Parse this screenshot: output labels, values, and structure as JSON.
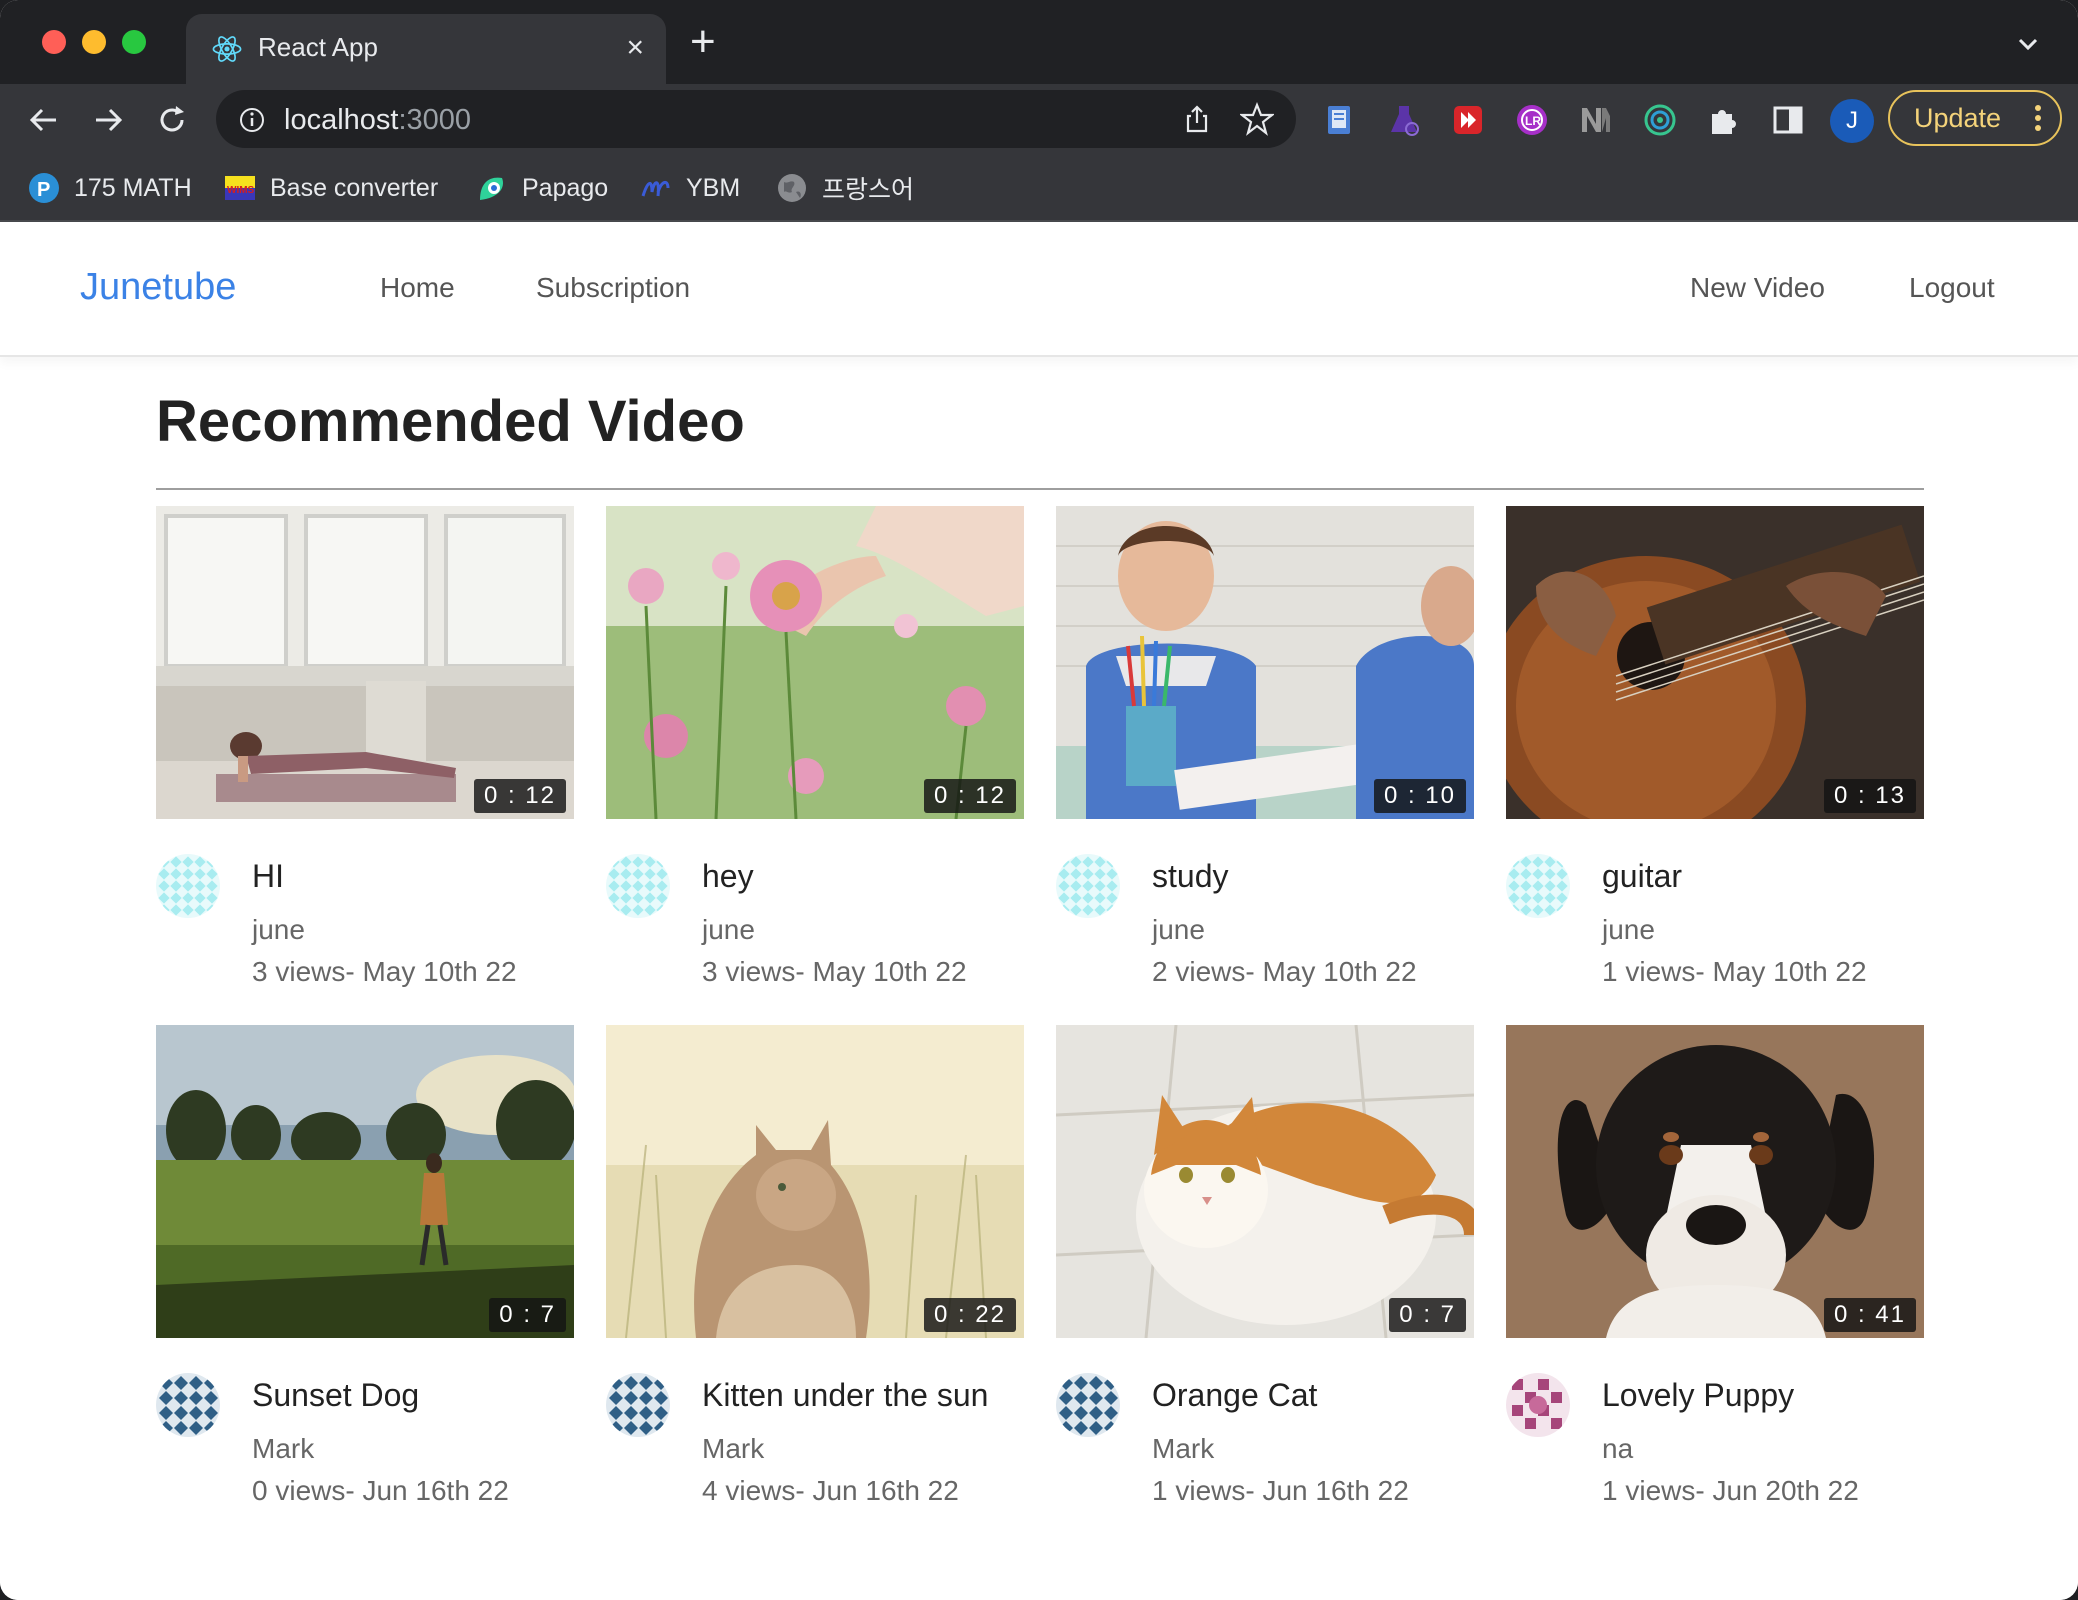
{
  "browser": {
    "tab_title": "React App",
    "tab_close": "×",
    "new_tab": "+",
    "url_host": "localhost",
    "url_port": ":3000",
    "profile_initial": "J",
    "update_label": "Update",
    "bookmarks": [
      {
        "label": "175 MATH",
        "icon": "pearson-icon"
      },
      {
        "label": "Base converter",
        "icon": "wims-icon"
      },
      {
        "label": "Papago",
        "icon": "papago-icon"
      },
      {
        "label": "YBM",
        "icon": "ybm-icon"
      },
      {
        "label": "프랑스어",
        "icon": "globe-icon"
      }
    ]
  },
  "navbar": {
    "brand": "Junetube",
    "links": [
      "Home",
      "Subscription"
    ],
    "right_links": [
      "New Video",
      "Logout"
    ]
  },
  "main": {
    "title": "Recommended Video",
    "videos": [
      {
        "title": "HI",
        "author": "june",
        "views": "3 views",
        "date": "- May 10th 22",
        "duration": "0 : 12",
        "scene": "yoga"
      },
      {
        "title": "hey",
        "author": "june",
        "views": "3 views",
        "date": "- May 10th 22",
        "duration": "0 : 12",
        "scene": "flowers"
      },
      {
        "title": "study",
        "author": "june",
        "views": "2 views",
        "date": "- May 10th 22",
        "duration": "0 : 10",
        "scene": "kids"
      },
      {
        "title": "guitar",
        "author": "june",
        "views": "1 views",
        "date": "- May 10th 22",
        "duration": "0 : 13",
        "scene": "guitar"
      },
      {
        "title": "Sunset Dog",
        "author": "Mark",
        "views": "0 views",
        "date": "- Jun 16th 22",
        "duration": "0 : 7",
        "scene": "field"
      },
      {
        "title": "Kitten under the sun",
        "author": "Mark",
        "views": "4 views",
        "date": "- Jun 16th 22",
        "duration": "0 : 22",
        "scene": "kitten"
      },
      {
        "title": "Orange Cat",
        "author": "Mark",
        "views": "1 views",
        "date": "- Jun 16th 22",
        "duration": "0 : 7",
        "scene": "orangecat"
      },
      {
        "title": "Lovely Puppy",
        "author": "na",
        "views": "1 views",
        "date": "- Jun 20th 22",
        "duration": "0 : 41",
        "scene": "puppy"
      }
    ]
  },
  "colors": {
    "brand": "#3b82e6",
    "avatar_june": "#a8ecf0",
    "avatar_mark": "#2f5f86",
    "avatar_na": "#a6457a"
  }
}
